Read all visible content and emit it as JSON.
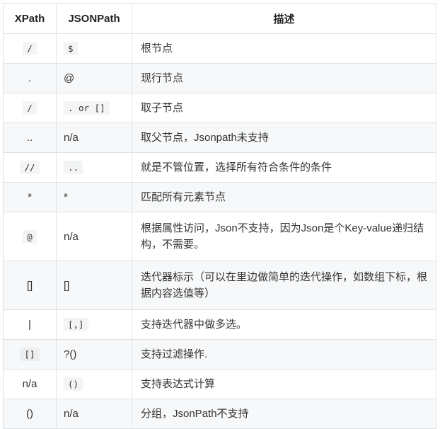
{
  "table": {
    "headers": [
      "XPath",
      "JSONPath",
      "描述"
    ],
    "rows": [
      {
        "xpath": "/",
        "xpath_code": true,
        "jsonpath": "$",
        "jsonpath_code": true,
        "desc": "根节点"
      },
      {
        "xpath": ".",
        "xpath_code": false,
        "jsonpath": "@",
        "jsonpath_code": false,
        "desc": "现行节点"
      },
      {
        "xpath": "/",
        "xpath_code": true,
        "jsonpath": ". or []",
        "jsonpath_code": true,
        "desc": "取子节点"
      },
      {
        "xpath": "..",
        "xpath_code": false,
        "jsonpath": "n/a",
        "jsonpath_code": false,
        "desc": "取父节点，Jsonpath未支持"
      },
      {
        "xpath": "//",
        "xpath_code": true,
        "jsonpath": "..",
        "jsonpath_code": true,
        "desc": "就是不管位置，选择所有符合条件的条件"
      },
      {
        "xpath": "*",
        "xpath_code": false,
        "jsonpath": "*",
        "jsonpath_code": false,
        "desc": "匹配所有元素节点"
      },
      {
        "xpath": "@",
        "xpath_code": true,
        "jsonpath": "n/a",
        "jsonpath_code": false,
        "desc": "根据属性访问，Json不支持，因为Json是个Key-value递归结构，不需要。"
      },
      {
        "xpath": "[]",
        "xpath_code": false,
        "jsonpath": "[]",
        "jsonpath_code": false,
        "desc": "迭代器标示（可以在里边做简单的迭代操作，如数组下标，根据内容选值等）"
      },
      {
        "xpath": "|",
        "xpath_code": false,
        "jsonpath": "[,]",
        "jsonpath_code": true,
        "desc": "支持迭代器中做多选。"
      },
      {
        "xpath": "[]",
        "xpath_code": true,
        "jsonpath": "?()",
        "jsonpath_code": false,
        "desc": "支持过滤操作."
      },
      {
        "xpath": "n/a",
        "xpath_code": false,
        "jsonpath": "()",
        "jsonpath_code": true,
        "desc": "支持表达式计算"
      },
      {
        "xpath": "()",
        "xpath_code": false,
        "jsonpath": "n/a",
        "jsonpath_code": false,
        "desc": "分组，JsonPath不支持"
      }
    ]
  }
}
